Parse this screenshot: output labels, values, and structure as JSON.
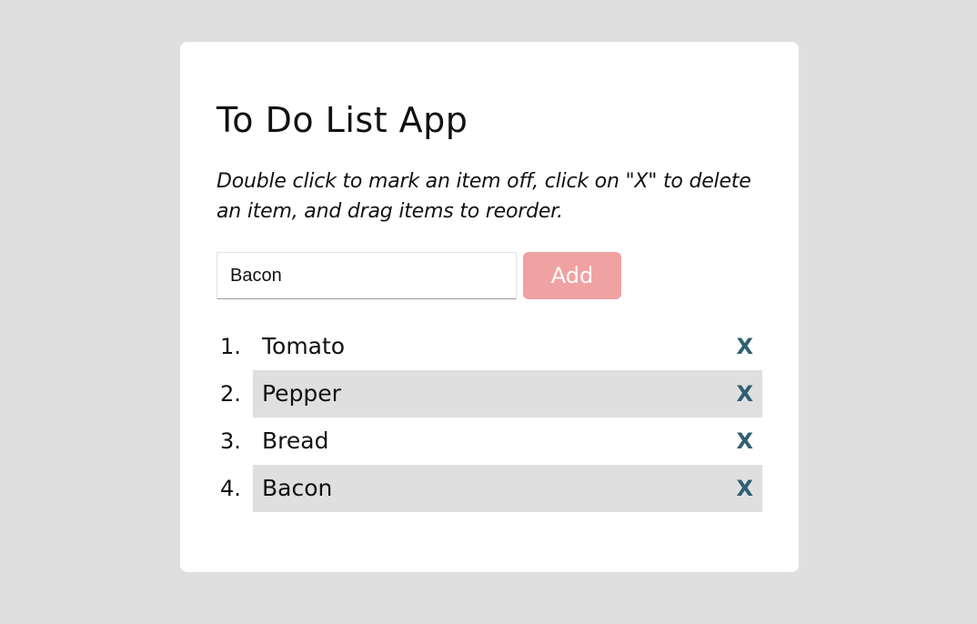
{
  "app": {
    "title": "To Do List App",
    "instructions": "Double click to mark an item off, click on \"X\" to delete an item, and drag items to reorder."
  },
  "form": {
    "input_value": "Bacon",
    "add_label": "Add"
  },
  "list": {
    "items": [
      {
        "number": "1.",
        "text": "Tomato",
        "delete_label": "X"
      },
      {
        "number": "2.",
        "text": "Pepper",
        "delete_label": "X"
      },
      {
        "number": "3.",
        "text": "Bread",
        "delete_label": "X"
      },
      {
        "number": "4.",
        "text": "Bacon",
        "delete_label": "X"
      }
    ]
  },
  "colors": {
    "page_background": "#dfdfdf",
    "card_background": "#ffffff",
    "add_button": "#f0a1a1",
    "delete_icon": "#2f5f72",
    "row_shade": "#dfdfdf"
  },
  "icons": {
    "delete": "close-icon"
  }
}
